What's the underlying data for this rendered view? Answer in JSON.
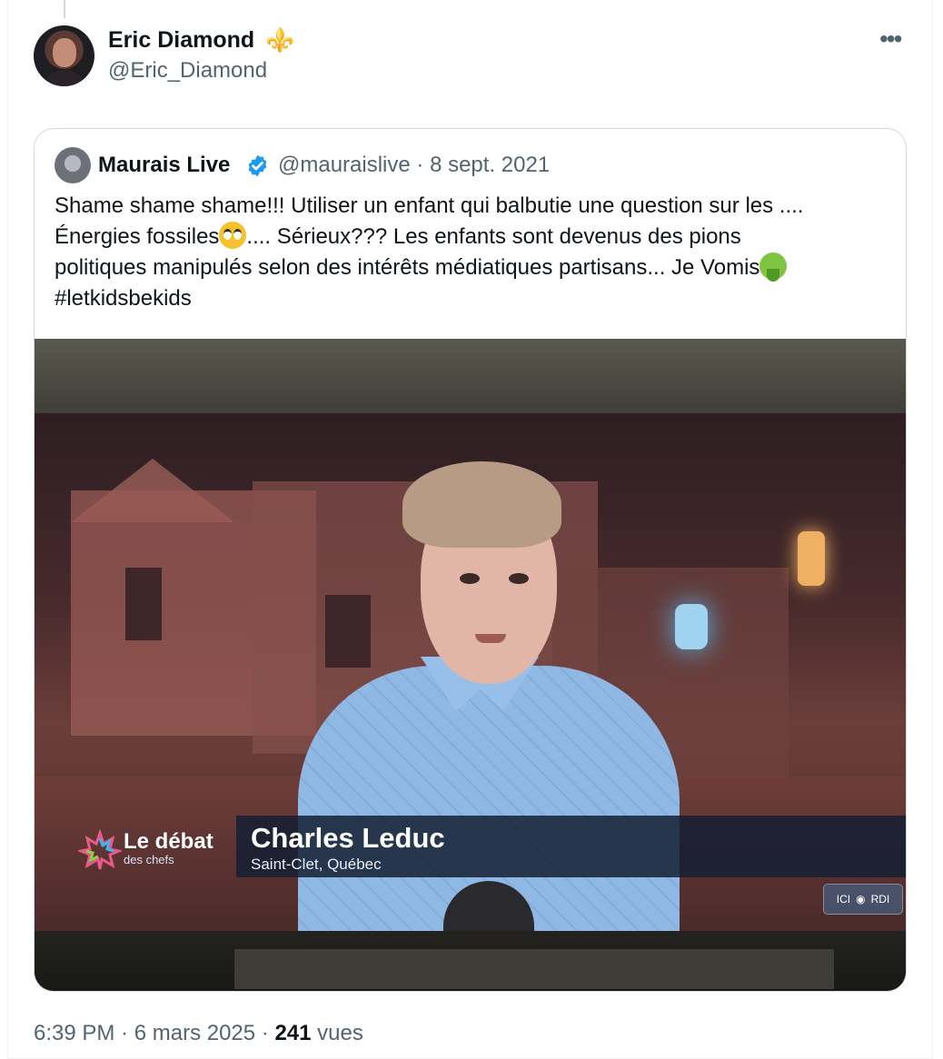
{
  "tweet": {
    "author_name": "Eric Diamond",
    "author_badge": "⚜️",
    "author_handle": "@Eric_Diamond",
    "more_icon": "more-horizontal-icon",
    "time": "6:39 PM",
    "sep1": " · ",
    "date": "6 mars 2025",
    "sep2": " · ",
    "views_count": "241",
    "views_label": " vues"
  },
  "quoted": {
    "author_name": "Maurais Live",
    "verified_icon": "verified-badge-icon",
    "verified_color": "#1d9bf0",
    "handle_date": "@mauraislive · 8 sept. 2021",
    "text_line1": "Shame shame shame!!! Utiliser un enfant qui balbutie une question sur les ....",
    "text_line2a": "Énergies fossiles",
    "text_line2b": ".... Sérieux??? Les enfants sont devenus des pions",
    "text_line3a": "politiques manipulés selon des intérêts médiatiques partisans... Je Vomis",
    "hashtag": "#letkidsbekids",
    "emoji1": "face-with-rolling-eyes-icon",
    "emoji2": "face-vomiting-icon"
  },
  "photo": {
    "lower_third_name": "Charles Leduc",
    "lower_third_place": "Saint-Clet, Québec",
    "show_title": "Le débat",
    "show_subtitle": "des chefs",
    "network_left": "ICI",
    "network_right": "RDI"
  }
}
